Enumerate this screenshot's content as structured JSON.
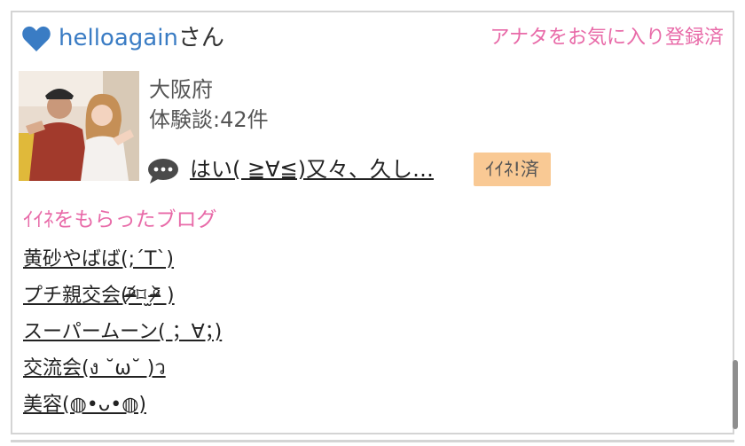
{
  "colors": {
    "username": "#3a7cc4",
    "accent_pink": "#e86aa8",
    "badge_bg": "#f9c994",
    "border": "#d4d4d4"
  },
  "header": {
    "icon": "heart-icon",
    "username": "helloagain",
    "suffix": "さん",
    "favorite_status": "アナタをお気に入り登録済"
  },
  "profile": {
    "photo": "profile-photo",
    "prefecture": "大阪府",
    "experience_count": "体験談:42件"
  },
  "comment": {
    "icon": "speech-bubble-icon",
    "text": "はい( ≧∀≦)又々、久し…",
    "like_badge": "ｲｲﾈ!済"
  },
  "liked_blogs": {
    "title": "ｲｲﾈをもらったブログ",
    "items": [
      "黄砂やばば(;´T`)",
      "プチ親交会(ᵒ̴̶̷᷄⌑ ̫ᵒ̴̶̷᷅ )",
      "スーパームーン( ；∀；)",
      "交流会(ง ˘ω˘ )ว",
      "美容(◍•ᴗ•◍)"
    ]
  }
}
